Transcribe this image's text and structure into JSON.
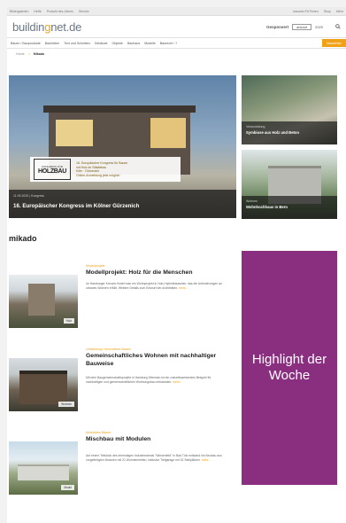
{
  "topbar": {
    "left": [
      "Bildergalerien",
      "Hefte",
      "Produkt des Jahres",
      "Service"
    ],
    "right": [
      "baunetz-Fit Ferien",
      "Shop",
      "Mehr"
    ]
  },
  "logo": {
    "part1": "buildin",
    "part2": "g",
    "part3": "net.de"
  },
  "sponsor": {
    "label": "Gesponsert",
    "box_text": "ankauf",
    "year": "2020"
  },
  "nav": {
    "items": [
      "Bauen / Bauprodukte",
      "Bauhütten",
      "Text und Schnitten",
      "Gebäude",
      "Objekte",
      "Bauhaus",
      "Modelle",
      "Baurecht / ?"
    ],
    "cta": "Newsletter"
  },
  "breadcrumb": {
    "home": "Home",
    "separator": ">",
    "current": "Mikado"
  },
  "hero": {
    "promo_logo_top": "KONGRESS FÜR",
    "promo_logo_main": "HOLZBAU",
    "promo_text": [
      "16. Europäischer Kongress für Bauen",
      "mit Holz im Städtebau",
      "Köln · Gürzenich",
      "Online-Anmeldung jetzt möglich"
    ],
    "meta": "11.09.2020 | Kongress",
    "title": "16. Europäischer Kongress im Kölner Gürzenich"
  },
  "side1": {
    "kicker": "Veranstaltung",
    "title": "Symbiose aus Holz und Beton"
  },
  "side2": {
    "kicker": "Wohnen",
    "title": "Wohnhochhaus in Bern"
  },
  "section_title": "mikado",
  "articles": [
    {
      "kicker": "Modellprojekt",
      "title": "Modellprojekt: Holz für die Menschen",
      "body": "Im Hamburger Kreuzer findet man ein Wohnprojekt in Holz-Hybridbauweise, das die Anforderungen an urbanes Wohnen erfüllt. Weitere Details zum Entwurf der Architekten.",
      "more": "mehr...",
      "tag": "Holz"
    },
    {
      "kicker": "Umsetzung / Innovatives Bauen",
      "title": "Gemeinschaftliches Wohnen mit nachhaltiger Bauweise",
      "body": "Mit dem Baugemeinschaftsprojekt in Hamburg-Ottensen ist ein zukunftsweisendes Beispiel für nachhaltigen und gemeinschaftlichen Wohnungsbau entstanden.",
      "more": "mehr...",
      "tag": "Wohnen"
    },
    {
      "kicker": "Modulares Bauen",
      "title": "Mischbau mit Modulen",
      "body": "Auf einem Teilstück des ehemaligen Industrieareals \"Wiesenfeld\" in Bad Tölz entstand ein Neubau aus vorgefertigten Modulen mit 21 Wohneinheiten, inklusive Tiefgarage mit 32 Stellplätzen.",
      "more": "mehr...",
      "tag": "Modul"
    }
  ],
  "highlight": {
    "text": "Highlight der Woche"
  },
  "colors": {
    "accent": "#f0a11a",
    "highlight_bg": "#8a2f80"
  }
}
